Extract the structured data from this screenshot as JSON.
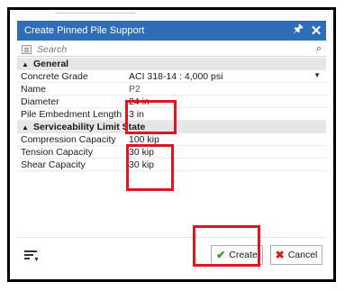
{
  "window": {
    "title": "Create Pinned Pile Support",
    "pin_glyph": " й",
    "pin_icon": "pin-icon",
    "close_glyph": "✕",
    "close_icon": "close-icon"
  },
  "search": {
    "placeholder": "Search",
    "search_icon": "magnifier-icon"
  },
  "sections": {
    "general": {
      "label": "General",
      "rows": {
        "concrete_grade": {
          "label": "Concrete Grade",
          "value": "ACI 318-14 : 4,000 psi"
        },
        "name": {
          "label": "Name",
          "value": "P2"
        },
        "diameter": {
          "label": "Diameter",
          "value": "24 in"
        },
        "embedment": {
          "label": "Pile Embedment Length",
          "value": "3 in"
        }
      }
    },
    "serviceability": {
      "label": "Serviceability Limit State",
      "rows": {
        "compression": {
          "label": "Compression Capacity",
          "value": "100 kip"
        },
        "tension": {
          "label": "Tension Capacity",
          "value": "30 kip"
        },
        "shear": {
          "label": "Shear Capacity",
          "value": "30 kip"
        }
      }
    }
  },
  "buttons": {
    "create_label": "Create",
    "cancel_label": "Cancel"
  },
  "colors": {
    "titlebar": "#2f6db8",
    "highlight": "#e3141d",
    "create_check": "#2a9a2a",
    "cancel_x": "#d41f1f"
  }
}
